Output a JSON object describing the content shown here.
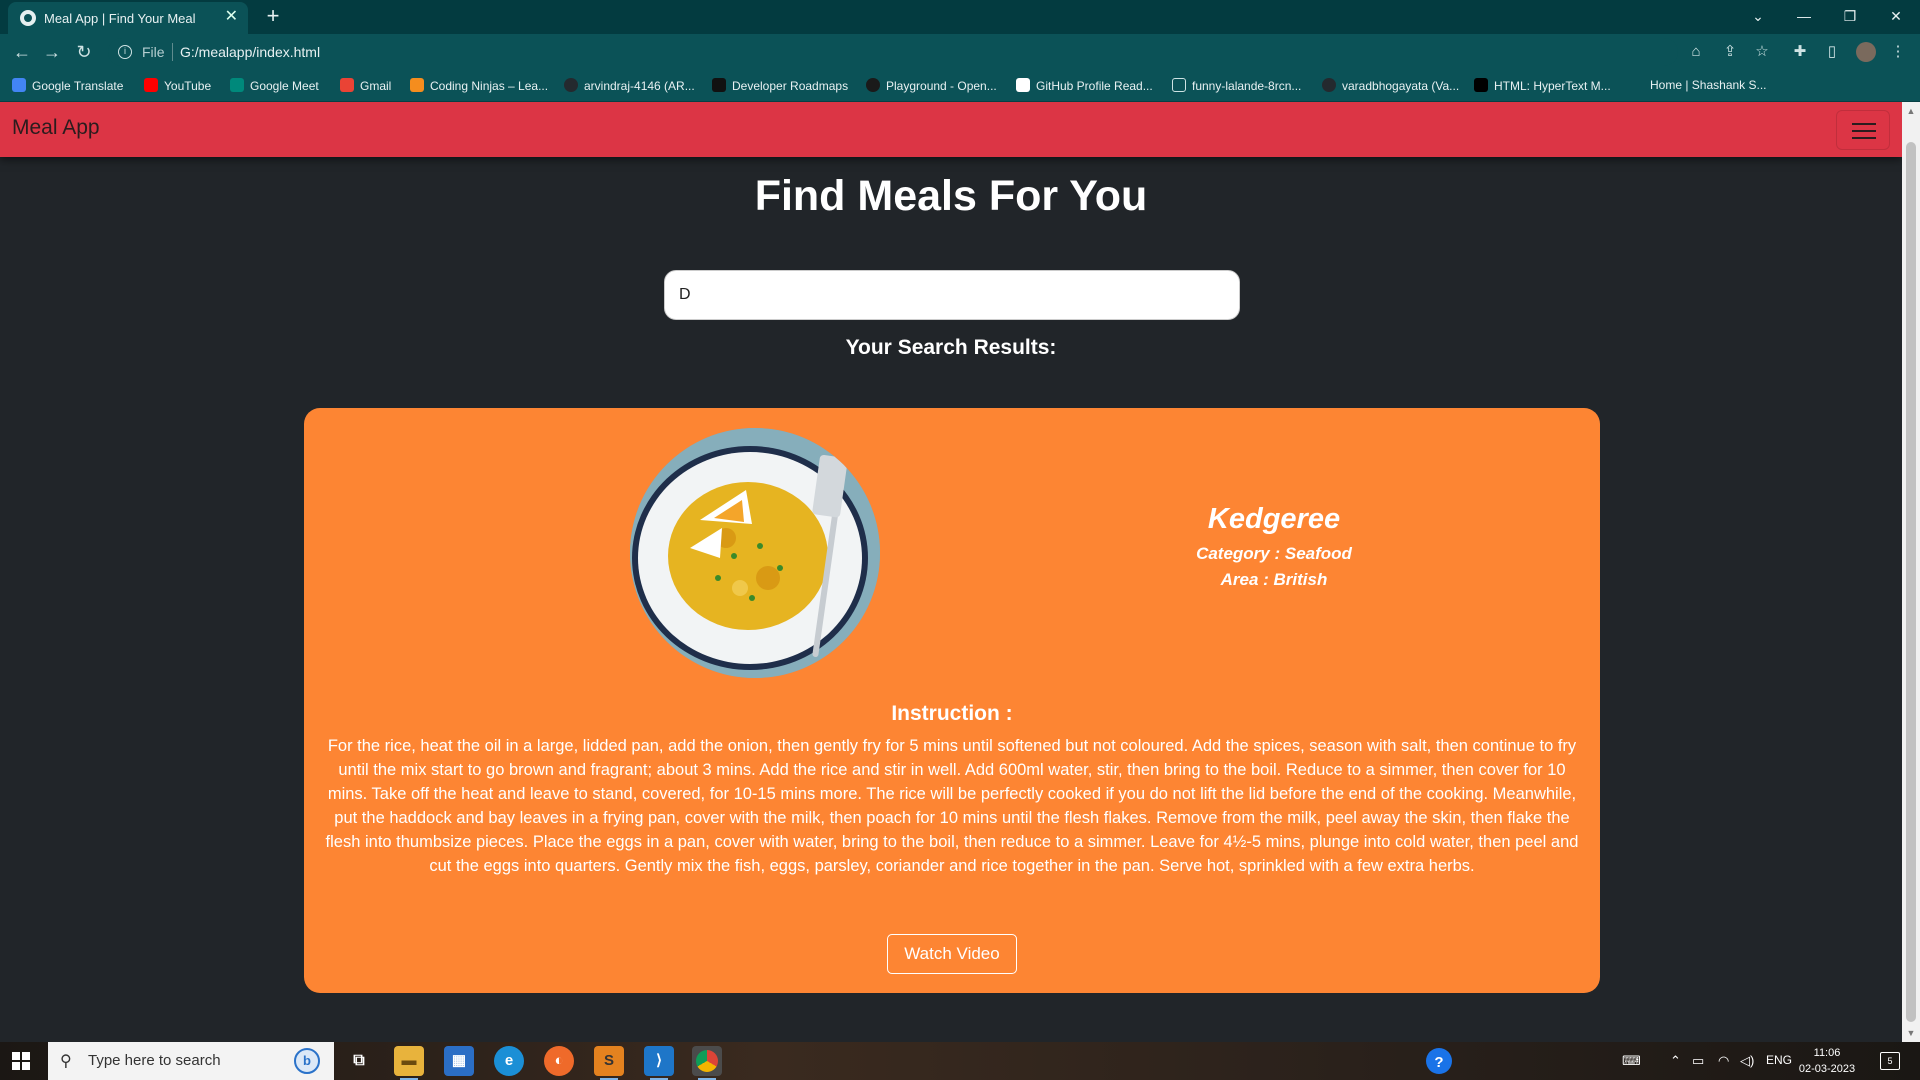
{
  "browser": {
    "tab_title": "Meal App | Find Your Meal",
    "tab_close": "✕",
    "new_tab": "+",
    "url_scheme": "File",
    "url": "G:/mealapp/index.html",
    "window_controls": {
      "dropdown": "⌄",
      "minimize": "—",
      "restore": "❐",
      "close": "✕"
    },
    "bookmarks": [
      {
        "label": "Google Translate",
        "icon": "google-translate-icon",
        "color": "#4285f4"
      },
      {
        "label": "YouTube",
        "icon": "youtube-icon",
        "color": "#ff0000"
      },
      {
        "label": "Google Meet",
        "icon": "google-meet-icon",
        "color": "#00897b"
      },
      {
        "label": "Gmail",
        "icon": "gmail-icon",
        "color": "#ea4335"
      },
      {
        "label": "Coding Ninjas – Lea...",
        "icon": "coding-ninjas-icon",
        "color": "#f58d1e"
      },
      {
        "label": "arvindraj-4146 (AR...",
        "icon": "github-icon",
        "color": "#24292e"
      },
      {
        "label": "Developer Roadmaps",
        "icon": "roadmap-icon",
        "color": "#111111"
      },
      {
        "label": "Playground - Open...",
        "icon": "openai-icon",
        "color": "#1a1a1a"
      },
      {
        "label": "GitHub Profile Read...",
        "icon": "readme-icon",
        "color": "#ffffff"
      },
      {
        "label": "funny-lalande-8rcn...",
        "icon": "page-icon",
        "color": "#0b5257"
      },
      {
        "label": "varadbhogayata (Va...",
        "icon": "github-icon",
        "color": "#24292e"
      },
      {
        "label": "HTML: HyperText M...",
        "icon": "mdn-icon",
        "color": "#000000"
      },
      {
        "label": "Home | Shashank S...",
        "icon": "",
        "color": ""
      }
    ]
  },
  "navbar": {
    "brand": "Meal App",
    "brand_color": "#dc3545"
  },
  "main": {
    "title": "Find Meals For You",
    "search_value": "D",
    "results_heading": "Your Search Results:"
  },
  "meal": {
    "name": "Kedgeree",
    "category": "Category : Seafood",
    "area": "Area : British",
    "instruction_heading": "Instruction :",
    "instructions": "For the rice, heat the oil in a large, lidded pan, add the onion, then gently fry for 5 mins until softened but not coloured. Add the spices, season with salt, then continue to fry until the mix start to go brown and fragrant; about 3 mins. Add the rice and stir in well. Add 600ml water, stir, then bring to the boil. Reduce to a simmer, then cover for 10 mins. Take off the heat and leave to stand, covered, for 10-15 mins more. The rice will be perfectly cooked if you do not lift the lid before the end of the cooking. Meanwhile, put the haddock and bay leaves in a frying pan, cover with the milk, then poach for 10 mins until the flesh flakes. Remove from the milk, peel away the skin, then flake the flesh into thumbsize pieces. Place the eggs in a pan, cover with water, bring to the boil, then reduce to a simmer. Leave for 4½-5 mins, plunge into cold water, then peel and cut the eggs into quarters. Gently mix the fish, eggs, parsley, coriander and rice together in the pan. Serve hot, sprinkled with a few extra herbs.",
    "watch_label": "Watch Video",
    "card_color": "#fd8533"
  },
  "taskbar": {
    "search_placeholder": "Type here to search",
    "bing_label": "b",
    "language": "ENG",
    "time": "11:06",
    "date": "02-03-2023",
    "notification_count": "5",
    "apps": [
      "task-view-icon",
      "file-explorer-icon",
      "microsoft-store-icon",
      "edge-icon",
      "firefox-icon",
      "sublime-text-icon",
      "vscode-icon",
      "chrome-icon"
    ]
  }
}
